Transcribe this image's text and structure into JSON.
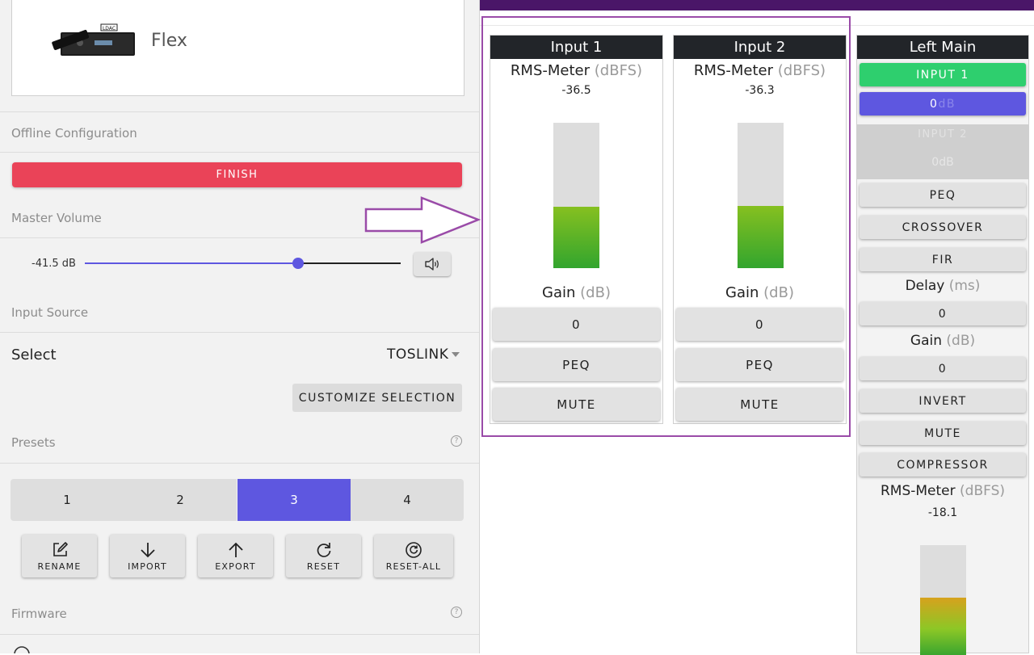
{
  "device": {
    "name": "Flex",
    "image_badge": "LDAC"
  },
  "sidebar": {
    "offline_config_label": "Offline Configuration",
    "finish_label": "FINISH",
    "master_volume": {
      "label": "Master Volume",
      "value": "-41.5 dB",
      "slider_fraction": 0.67
    },
    "input_source": {
      "label": "Input Source",
      "select_label": "Select",
      "selected_value": "TOSLINK",
      "customize_label": "CUSTOMIZE SELECTION"
    },
    "presets": {
      "label": "Presets",
      "help": "?",
      "items": [
        {
          "label": "1",
          "active": false
        },
        {
          "label": "2",
          "active": false
        },
        {
          "label": "3",
          "active": true
        },
        {
          "label": "4",
          "active": false
        }
      ],
      "actions": [
        {
          "label": "RENAME",
          "icon": "edit-icon"
        },
        {
          "label": "IMPORT",
          "icon": "arrow-down-icon"
        },
        {
          "label": "EXPORT",
          "icon": "arrow-up-icon"
        },
        {
          "label": "RESET",
          "icon": "refresh-icon"
        },
        {
          "label": "RESET-ALL",
          "icon": "reset-all-icon"
        }
      ]
    },
    "firmware": {
      "label": "Firmware",
      "help": "?"
    }
  },
  "inputs": [
    {
      "title": "Input 1",
      "meter_label": "RMS-Meter",
      "meter_unit": "(dBFS)",
      "meter_value": "-36.5",
      "meter_level": 0.42,
      "gain_label": "Gain",
      "gain_unit": "(dB)",
      "gain_value": "0",
      "peq_label": "PEQ",
      "mute_label": "MUTE"
    },
    {
      "title": "Input 2",
      "meter_label": "RMS-Meter",
      "meter_unit": "(dBFS)",
      "meter_value": "-36.3",
      "meter_level": 0.43,
      "gain_label": "Gain",
      "gain_unit": "(dB)",
      "gain_value": "0",
      "peq_label": "PEQ",
      "mute_label": "MUTE"
    }
  ],
  "left_main": {
    "title": "Left Main",
    "input1_label": "INPUT 1",
    "input1_gain": "0",
    "input2_label": "INPUT 2",
    "input2_gain": "0",
    "db_unit": "dB",
    "peq_label": "PEQ",
    "crossover_label": "CROSSOVER",
    "fir_label": "FIR",
    "delay_label": "Delay",
    "delay_unit": "(ms)",
    "delay_value": "0",
    "gain_label": "Gain",
    "gain_unit": "(dB)",
    "gain_value": "0",
    "invert_label": "INVERT",
    "mute_label": "MUTE",
    "compressor_label": "COMPRESSOR",
    "meter_label": "RMS-Meter",
    "meter_unit": "(dBFS)",
    "meter_value": "-18.1",
    "meter_level": 0.52
  },
  "colors": {
    "accent": "#5e57e0",
    "finish": "#ea4358",
    "active_green": "#2ecf6e",
    "top_bar": "#4a1668",
    "highlight": "#9a4ba8"
  }
}
